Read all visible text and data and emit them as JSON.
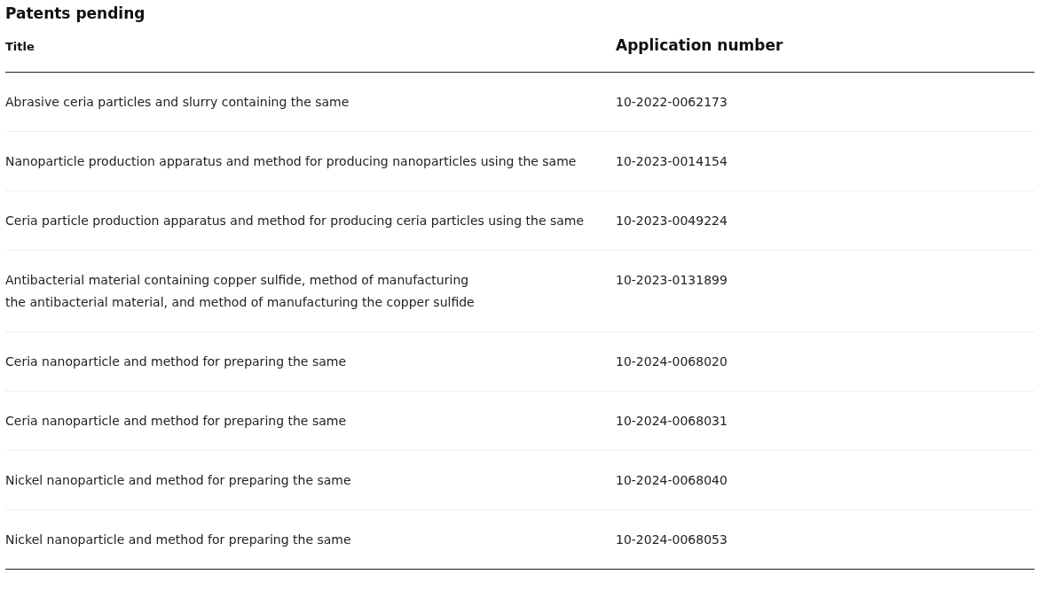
{
  "heading": "Patents pending",
  "table": {
    "columns": [
      "Title",
      "Application number"
    ],
    "rows": [
      {
        "title": "Abrasive ceria particles and slurry containing the same",
        "application_number": "10-2022-0062173"
      },
      {
        "title": "Nanoparticle production apparatus and method for producing nanoparticles using the same",
        "application_number": "10-2023-0014154"
      },
      {
        "title": "Ceria particle production apparatus and method for producing ceria particles using the same",
        "application_number": "10-2023-0049224"
      },
      {
        "title": "Antibacterial material containing copper sulfide, method of manufacturing\nthe antibacterial material, and method of manufacturing the copper sulfide",
        "application_number": "10-2023-0131899"
      },
      {
        "title": "Ceria nanoparticle and method for preparing the same",
        "application_number": "10-2024-0068020"
      },
      {
        "title": "Ceria nanoparticle and method for preparing the same",
        "application_number": "10-2024-0068031"
      },
      {
        "title": "Nickel nanoparticle and method for preparing the same",
        "application_number": "10-2024-0068040"
      },
      {
        "title": "Nickel nanoparticle and method for preparing the same",
        "application_number": "10-2024-0068053"
      }
    ]
  }
}
